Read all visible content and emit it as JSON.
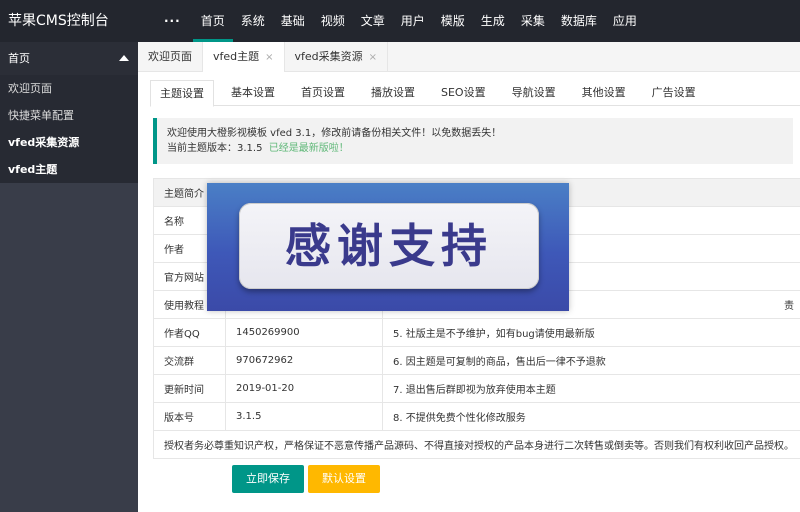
{
  "app": {
    "title": "苹果CMS控制台"
  },
  "topnav": {
    "more": "···",
    "items": [
      "首页",
      "系统",
      "基础",
      "视频",
      "文章",
      "用户",
      "模版",
      "生成",
      "采集",
      "数据库",
      "应用"
    ]
  },
  "sidebar": {
    "head": "首页",
    "items": [
      "欢迎页面",
      "快捷菜单配置",
      "vfed采集资源",
      "vfed主题"
    ]
  },
  "page_tabs": [
    {
      "label": "欢迎页面"
    },
    {
      "label": "vfed主题",
      "close": "×"
    },
    {
      "label": "vfed采集资源",
      "close": "×"
    }
  ],
  "settings_tabs": [
    "主题设置",
    "基本设置",
    "首页设置",
    "播放设置",
    "SEO设置",
    "导航设置",
    "其他设置",
    "广告设置"
  ],
  "notice": {
    "line1": "欢迎使用大橙影视模板 vfed 3.1，修改前请备份相关文件！以免数据丢失！",
    "line2_prefix": "当前主题版本：3.1.5",
    "line2_status": "已经是最新版啦！"
  },
  "info_table": {
    "header": "主题简介",
    "rows": [
      {
        "label": "名称",
        "value": "",
        "note": ""
      },
      {
        "label": "作者",
        "value": "",
        "note": ""
      },
      {
        "label": "官方网站",
        "value": "",
        "note": ""
      },
      {
        "label": "使用教程",
        "value": "",
        "note": "责"
      },
      {
        "label": "作者QQ",
        "value": "1450269900",
        "note": "5. 社版主是不予维护，如有bug请使用最新版"
      },
      {
        "label": "交流群",
        "value": "970672962",
        "note": "6. 因主题是可复制的商品，售出后一律不予退款"
      },
      {
        "label": "更新时间",
        "value": "2019-01-20",
        "note": "7. 退出售后群即视为放弃使用本主题"
      },
      {
        "label": "版本号",
        "value": "3.1.5",
        "note": "8. 不提供免费个性化修改服务"
      }
    ],
    "footer": "授权者务必尊重知识产权，严格保证不恶意传播产品源码、不得直接对授权的产品本身进行二次转售或倒卖等。否则我们有权利收回产品授权。"
  },
  "buttons": {
    "save": "立即保存",
    "reset": "默认设置"
  },
  "watermark": {
    "text": "感谢支持"
  },
  "colors": {
    "accent": "#009688",
    "warn": "#ffb800",
    "header_bg": "#23262e",
    "sidebar_bg": "#393d49"
  }
}
